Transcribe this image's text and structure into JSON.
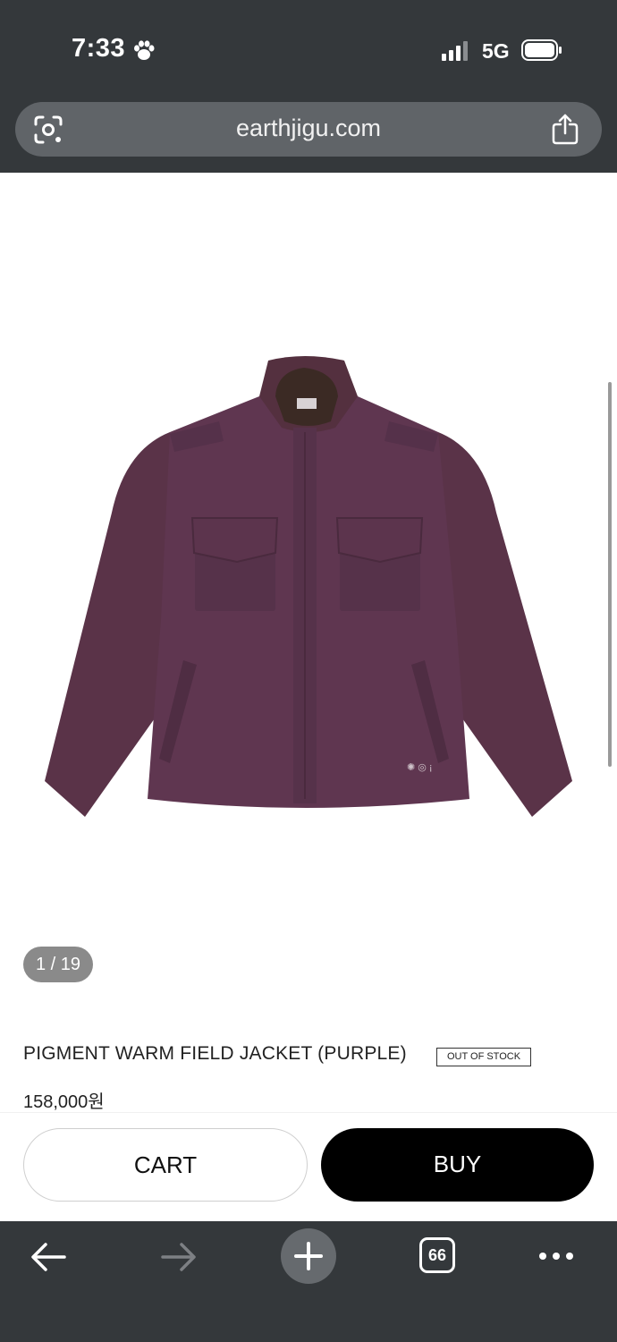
{
  "status_bar": {
    "time": "7:33",
    "network": "5G"
  },
  "browser": {
    "url": "earthjigu.com"
  },
  "product": {
    "image_counter": "1 / 19",
    "title": "PIGMENT WARM FIELD JACKET (PURPLE)",
    "badge": "OUT OF STOCK",
    "price": "158,000원",
    "jacket_color": "#5a3348"
  },
  "actions": {
    "cart_label": "CART",
    "buy_label": "BUY"
  },
  "toolbar": {
    "tab_count": "66"
  }
}
